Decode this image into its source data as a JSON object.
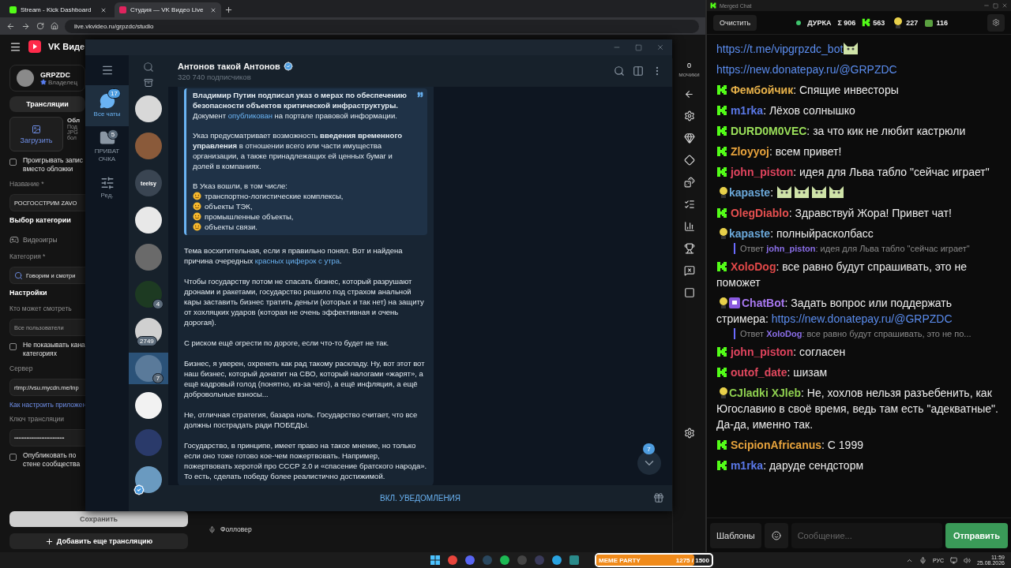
{
  "browser": {
    "tabs": [
      {
        "title": "Stream - Kick Dashboard",
        "selected": false
      },
      {
        "title": "Студия — VK Видео Live",
        "selected": true
      }
    ],
    "url": "live.vkvideo.ru/grpzdc/studio"
  },
  "vk": {
    "brand": "VK Виде",
    "profile": {
      "name": "GRPZDC",
      "role": "Владелец"
    },
    "tab": "Трансляции",
    "upload": "Загрузить",
    "cover_title": "Обл",
    "cover_hints": [
      "Под",
      "JPG",
      "бол"
    ],
    "form": [
      {
        "kind": "checkbox",
        "label": "Проигрывать запис вместо обложки",
        "checked": false
      },
      {
        "kind": "label",
        "text": "Название *"
      },
      {
        "kind": "field",
        "value": "РОСГОССТРИМ ZAVO"
      },
      {
        "kind": "heading",
        "text": "Выбор категории"
      },
      {
        "kind": "category",
        "text": "Видеоигры"
      },
      {
        "kind": "label",
        "text": "Категория *"
      },
      {
        "kind": "search",
        "value": "Говорим и смотри"
      },
      {
        "kind": "heading",
        "text": "Настройки"
      },
      {
        "kind": "label",
        "text": "Кто может смотреть"
      },
      {
        "kind": "select",
        "value": "Все пользователи"
      },
      {
        "kind": "checkbox",
        "label": "Не показывать кана категориях",
        "checked": false
      },
      {
        "kind": "label",
        "text": "Сервер"
      },
      {
        "kind": "field",
        "value": "rtmp://vsu.mycdn.me/inp"
      },
      {
        "kind": "link",
        "text": "Как настроить приложен"
      },
      {
        "kind": "label",
        "text": "Ключ трансляции"
      },
      {
        "kind": "field",
        "value": "•••••••••••••••••••••••••••••••••"
      },
      {
        "kind": "checkbox",
        "label": "Опубликовать по стене сообщества",
        "checked": false
      }
    ],
    "save": "Сохранить",
    "add": "Добавить еще трансляцию",
    "stat_value": "0",
    "stat_label": "мочики",
    "follower": "Фолловер"
  },
  "telegram": {
    "folders": [
      {
        "label": "Все чаты",
        "badge": "17",
        "selected": true,
        "kind": "chats"
      },
      {
        "label": "ПРИВАТ ОЧКА",
        "badge": "5",
        "selected": false,
        "kind": "folder"
      },
      {
        "label": "Ред.",
        "selected": false,
        "kind": "edit"
      }
    ],
    "chats": [
      {
        "selected": false
      },
      {
        "selected": false
      },
      {
        "selected": false,
        "label": "teelsy"
      },
      {
        "selected": false
      },
      {
        "selected": false
      },
      {
        "selected": false,
        "badge": "4"
      },
      {
        "selected": false,
        "badge": "2749"
      },
      {
        "selected": true,
        "badge": "7"
      },
      {
        "selected": false
      },
      {
        "selected": false
      },
      {
        "selected": false,
        "verified": true
      }
    ],
    "channel": {
      "title": "Антонов такой Антонов",
      "subtitle": "320 740 подписчиков"
    },
    "quote": {
      "paragraphs": [
        [
          {
            "kind": "text",
            "text": "**Владимир Путин подписал указ о мерах по обеспечению безопасности объектов критической инфраструктуры.** Документ "
          },
          {
            "kind": "link",
            "text": "опубликован"
          },
          {
            "kind": "text",
            "text": " на портале правовой информации."
          }
        ],
        [
          {
            "kind": "text",
            "text": "Указ предусматривает возможность **введения временного управления** в отношении всего или части имущества организации, а также принадлежащих ей ценных бумаг и долей в компаниях."
          }
        ]
      ],
      "list_intro": "В Указ вошли, в том числе:",
      "items": [
        "транспортно-логистические комплексы,",
        "объекты ТЭК,",
        "промышленные объекты,",
        "объекты связи."
      ]
    },
    "paragraphs": [
      [
        {
          "kind": "text",
          "text": "Тема восхитительная, если я правильно понял. Вот и найдена причина очередных "
        },
        {
          "kind": "link",
          "text": "красных циферок с утра"
        },
        {
          "kind": "text",
          "text": "."
        }
      ],
      [
        {
          "kind": "text",
          "text": "Чтобы государству потом не спасать бизнес, который разрушают дронами и ракетами, государство решило под страхом анальной кары заставить бизнес тратить деньги (которых и так нет) на защиту от хохляцких ударов (которая не очень эффективная и очень дорогая)."
        }
      ],
      [
        {
          "kind": "text",
          "text": "С риском ещё огрести по дороге, если что-то будет не так."
        }
      ],
      [
        {
          "kind": "text",
          "text": "Бизнес, я уверен, охренеть как рад такому раскладу. Ну, вот этот вот наш бизнес, который донатит на СВО, который налогами «жарят», а ещё кадровый голод (понятно, из-за чего), а ещё инфляция, а ещё добровольные взносы..."
        }
      ],
      [
        {
          "kind": "text",
          "text": "Не, отличная стратегия, базара ноль. Государство считает, что все должны пострадать ради ПОБЕДЫ."
        }
      ],
      [
        {
          "kind": "text",
          "text": "Государство, в принципе, имеет право на такое мнение, но только если оно тоже готово кое-чем пожертвовать. Например, пожертвовать херотой про СССР 2.0 и «спасение братского народа». То есть, сделать победу более реалистично достижимой."
        }
      ]
    ],
    "unread": "7",
    "notify": "ВКЛ. УВЕДОМЛЕНИЯ"
  },
  "chat": {
    "title": "Merged Chat",
    "clear": "Очистить",
    "channel": "ДУРКА",
    "stats": [
      {
        "kind": "sum",
        "value": "Σ 906"
      },
      {
        "kind": "kick",
        "value": "563"
      },
      {
        "kind": "emote",
        "value": "227"
      },
      {
        "kind": "frog",
        "value": "116"
      }
    ],
    "messages": [
      {
        "kind": "continuation",
        "parts": [
          {
            "kind": "link",
            "text": "https://t.me/vipgrpzdc_bot"
          },
          {
            "kind": "emote"
          }
        ]
      },
      {
        "kind": "continuation",
        "parts": [
          {
            "kind": "link",
            "text": "https://new.donatepay.ru/@GRPZDC"
          }
        ]
      },
      {
        "kind": "kick",
        "user": "Фембойчик",
        "color": "#e8b24a",
        "parts": [
          {
            "kind": "text",
            "text": ": Спящие инвесторы"
          }
        ]
      },
      {
        "kind": "kick",
        "user": "m1rka",
        "color": "#5a78e6",
        "parts": [
          {
            "kind": "text",
            "text": ": Лёхов солнышко"
          }
        ]
      },
      {
        "kind": "kick",
        "user": "DURD0M0VEC",
        "color": "#9be05a",
        "parts": [
          {
            "kind": "text",
            "text": ": за что кик не любит кастрюли"
          }
        ]
      },
      {
        "kind": "kick",
        "user": "Zloyyoj",
        "color": "#e6a23c",
        "parts": [
          {
            "kind": "text",
            "text": ": всем привет!"
          }
        ]
      },
      {
        "kind": "kick",
        "user": "john_piston",
        "color": "#e0445e",
        "parts": [
          {
            "kind": "text",
            "text": ": идея для Льва табло \"сейчас играет\""
          }
        ]
      },
      {
        "kind": "emote",
        "user": "kapaste",
        "color": "#6aa6d6",
        "parts": [
          {
            "kind": "text",
            "text": ": "
          },
          {
            "kind": "emote"
          },
          {
            "kind": "emote"
          },
          {
            "kind": "emote"
          },
          {
            "kind": "emote"
          }
        ]
      },
      {
        "kind": "kick",
        "user": "OlegDiablo",
        "color": "#e65050",
        "parts": [
          {
            "kind": "text",
            "text": ": Здравствуй Жора! Привет чат!"
          }
        ]
      },
      {
        "kind": "emote",
        "user": "kapaste",
        "color": "#6aa6d6",
        "parts": [
          {
            "kind": "text",
            "text": ": полныйрасколбасс"
          }
        ],
        "reply": {
          "label": "Ответ",
          "user": "john_piston",
          "color": "#8a6ee8",
          "text": ": идея для Льва табло \"сейчас играет\""
        }
      },
      {
        "kind": "kick",
        "user": "XoloDog",
        "color": "#e04848",
        "parts": [
          {
            "kind": "text",
            "text": ": все равно будут спрашивать, это не поможет"
          }
        ]
      },
      {
        "kind": "bot",
        "user": "ChatBot",
        "color": "#a878f0",
        "parts": [
          {
            "kind": "text",
            "text": ": Задать вопрос или поддержать стримера: "
          },
          {
            "kind": "link",
            "text": "https://new.donatepay.ru/@GRPZDC"
          }
        ],
        "reply": {
          "label": "Ответ",
          "user": "XoloDog",
          "color": "#8a6ee8",
          "text": ": все равно будут спрашивать, это не по..."
        }
      },
      {
        "kind": "kick",
        "user": "john_piston",
        "color": "#e0445e",
        "parts": [
          {
            "kind": "text",
            "text": ": согласен"
          }
        ]
      },
      {
        "kind": "kick",
        "user": "outof_date",
        "color": "#e0485e",
        "parts": [
          {
            "kind": "text",
            "text": ": шизам"
          }
        ]
      },
      {
        "kind": "emote",
        "user": "CJladki XJleb",
        "color": "#8fd050",
        "parts": [
          {
            "kind": "text",
            "text": ": Не, хохлов нельзя разъебенить, как Югославию в своё время, ведь там есть \"адекватные\". Да-да, именно так."
          }
        ]
      },
      {
        "kind": "kick",
        "user": "ScipionAfricanus",
        "color": "#e6a23c",
        "parts": [
          {
            "kind": "text",
            "text": ": С 1999"
          }
        ]
      },
      {
        "kind": "kick",
        "user": "m1rka",
        "color": "#5a78e6",
        "parts": [
          {
            "kind": "text",
            "text": ": даруде сендсторм"
          }
        ]
      }
    ],
    "templates": "Шаблоны",
    "placeholder": "Сообщение...",
    "send": "Отправить"
  },
  "taskbar": {
    "meme": {
      "title": "MEME PARTY",
      "count": "1275 / 1500",
      "level": 0.85
    },
    "lang": "РУС",
    "time": "11:59",
    "date": "25.08.2026"
  }
}
